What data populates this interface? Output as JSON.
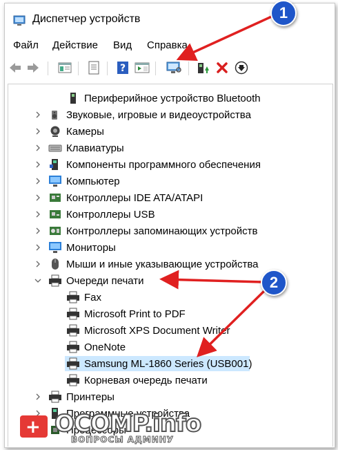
{
  "window": {
    "title": "Диспетчер устройств"
  },
  "menu": [
    "Файл",
    "Действие",
    "Вид",
    "Справка"
  ],
  "toolbar": {
    "buttons": [
      "back-arrow-icon",
      "forward-arrow-icon",
      "properties-icon",
      "console-tree-icon",
      "help-icon",
      "action-pane-icon",
      "scan-hardware-icon",
      "update-driver-icon",
      "uninstall-icon",
      "disable-device-icon"
    ]
  },
  "tree": {
    "items": [
      {
        "label": "Периферийное устройство Bluetooth",
        "level": 1,
        "icon": "bluetooth-device-icon",
        "expanded": null
      },
      {
        "label": "Звуковые, игровые и видеоустройства",
        "level": 0,
        "icon": "speaker-icon",
        "expanded": false
      },
      {
        "label": "Камеры",
        "level": 0,
        "icon": "camera-icon",
        "expanded": false
      },
      {
        "label": "Клавиатуры",
        "level": 0,
        "icon": "keyboard-icon",
        "expanded": false
      },
      {
        "label": "Компоненты программного обеспечения",
        "level": 0,
        "icon": "software-component-icon",
        "expanded": false
      },
      {
        "label": "Компьютер",
        "level": 0,
        "icon": "computer-icon",
        "expanded": false
      },
      {
        "label": "Контроллеры IDE ATA/ATAPI",
        "level": 0,
        "icon": "ide-controller-icon",
        "expanded": false
      },
      {
        "label": "Контроллеры USB",
        "level": 0,
        "icon": "usb-controller-icon",
        "expanded": false
      },
      {
        "label": "Контроллеры запоминающих устройств",
        "level": 0,
        "icon": "storage-controller-icon",
        "expanded": false
      },
      {
        "label": "Мониторы",
        "level": 0,
        "icon": "monitor-icon",
        "expanded": false
      },
      {
        "label": "Мыши и иные указывающие устройства",
        "level": 0,
        "icon": "mouse-icon",
        "expanded": false
      },
      {
        "label": "Очереди печати",
        "level": 0,
        "icon": "print-queue-icon",
        "expanded": true
      },
      {
        "label": "Fax",
        "level": 1,
        "icon": "printer-icon",
        "expanded": null
      },
      {
        "label": "Microsoft Print to PDF",
        "level": 1,
        "icon": "printer-icon",
        "expanded": null
      },
      {
        "label": "Microsoft XPS Document Writer",
        "level": 1,
        "icon": "printer-icon",
        "expanded": null
      },
      {
        "label": "OneNote",
        "level": 1,
        "icon": "printer-icon",
        "expanded": null
      },
      {
        "label": "Samsung ML-1860 Series (USB001)",
        "level": 1,
        "icon": "printer-icon",
        "expanded": null,
        "selected": true
      },
      {
        "label": "Корневая очередь печати",
        "level": 1,
        "icon": "printer-icon",
        "expanded": null
      },
      {
        "label": "Принтеры",
        "level": 0,
        "icon": "printer-icon",
        "expanded": false
      },
      {
        "label": "Программные устройства",
        "level": 0,
        "icon": "software-device-icon",
        "expanded": false
      },
      {
        "label": "Процессоры",
        "level": 0,
        "icon": "processor-icon",
        "expanded": false
      }
    ]
  },
  "callouts": [
    "1",
    "2"
  ],
  "watermark": {
    "title": "OCOMP.info",
    "subtitle": "ВОПРОСЫ АДМИНУ"
  },
  "colors": {
    "callout": "#1f56c9",
    "arrow": "#e02020",
    "selection": "#cce8ff"
  }
}
